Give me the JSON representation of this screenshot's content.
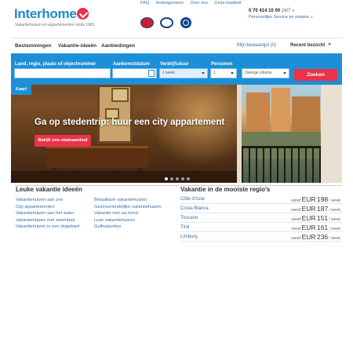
{
  "header": {
    "logo": "Interhome",
    "tagline": "Vakantiehuizen en appartementen sinds 1965",
    "top_links": [
      "FAQ",
      "Huiseigenaren",
      "Over ons",
      "Onze kwaliteit"
    ],
    "phone": "0 70 414 10 00",
    "phone_hours": "24/7 »",
    "service_link": "Persoonlijke Service ter plaatse »"
  },
  "nav": {
    "items": [
      "Bestemmingen",
      "Vakantie-ideeën",
      "Aanbiedingen"
    ],
    "watchlist": "Mijn bewaarlijst (0)",
    "recent": "Recent bezocht"
  },
  "search": {
    "destination_label": "Land, regio, plaats of objectnummer",
    "destination_value": "",
    "arrival_label": "Aankomstdatum",
    "arrival_value": "",
    "duration_label": "Verblijfsduur",
    "duration_value": "1 week",
    "persons_label": "Personen",
    "persons_value": "1",
    "criteria_value": "Overige criteria",
    "search_button": "Zoeken"
  },
  "map_button": "Kaart",
  "hero": {
    "title": "Ga op stedentrip: huur een city appartement",
    "button": "Bekijk ons stadsaanbod"
  },
  "ideas": {
    "heading": "Leuke vakantie ideeën",
    "col1": [
      "Vakantiehuizen aan zee",
      "City appartementen",
      "Vakantiehuizen aan het water",
      "Vakantiehuizen met zwembad",
      "Vakantiehuizen in een skigebied"
    ],
    "col2": [
      "Betaalbare vakantiehuizen",
      "Gezinsvriendelijke vakantiehuizen",
      "Vakantie met uw hond",
      "Luxe vakantiehuizen",
      "Golfvakanties"
    ]
  },
  "regions": {
    "heading": "Vakantie in de mooiste regio's",
    "rows": [
      {
        "name": "Côte d'Azur",
        "prefix": "vanaf",
        "currency": "EUR",
        "amount": "198",
        "unit": "/ week"
      },
      {
        "name": "Costa Blanca",
        "prefix": "vanaf",
        "currency": "EUR",
        "amount": "187",
        "unit": "/ week"
      },
      {
        "name": "Toscane",
        "prefix": "vanaf",
        "currency": "EUR",
        "amount": "151",
        "unit": "/ week"
      },
      {
        "name": "Tirol",
        "prefix": "vanaf",
        "currency": "EUR",
        "amount": "161",
        "unit": "/ week"
      },
      {
        "name": "Limburg",
        "prefix": "vanaf",
        "currency": "EUR",
        "amount": "236",
        "unit": "/ week"
      }
    ]
  },
  "colors": {
    "brand_blue": "#1d8fd6",
    "accent_red": "#e8334a",
    "link_blue": "#3a6ea5"
  }
}
